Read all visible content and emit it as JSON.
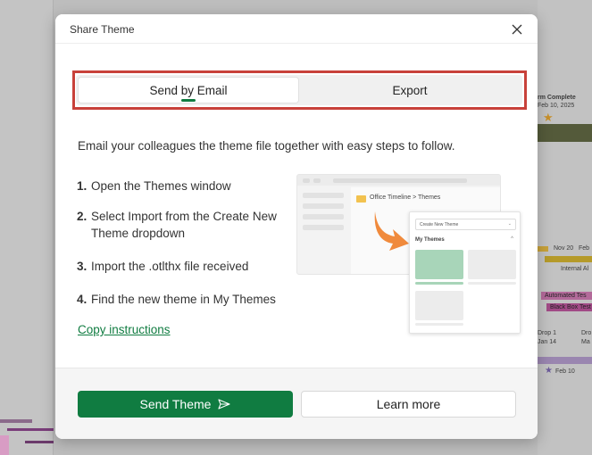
{
  "background": {
    "right_texts": [
      "rm Complete",
      "Feb 10, 2025",
      "Nov 20",
      "Feb",
      "Internal Al",
      "Automated Tes",
      "Black Box Test",
      "Drop 1",
      "Dro",
      "Jan 14",
      "Ma",
      "Feb 10"
    ]
  },
  "dialog": {
    "title": "Share Theme",
    "close_icon": "close-icon"
  },
  "tabs": [
    {
      "label": "Send by Email",
      "active": true
    },
    {
      "label": "Export",
      "active": false
    }
  ],
  "intro": "Email your colleagues the theme file together with easy steps to follow.",
  "steps": [
    {
      "num": "1.",
      "text": "Open the Themes window"
    },
    {
      "num": "2.",
      "text": "Select Import from the Create New Theme dropdown"
    },
    {
      "num": "3.",
      "text": "Import the .otlthx file received"
    },
    {
      "num": "4.",
      "text": "Find the new theme in My Themes"
    }
  ],
  "copy_link": "Copy instructions",
  "illustration": {
    "path": "Office Timeline > Themes",
    "dropdown": "Create New Theme",
    "section": "My Themes"
  },
  "footer": {
    "send_label": "Send Theme",
    "learn_label": "Learn more"
  },
  "colors": {
    "accent": "#107c41",
    "highlight": "#c8413a"
  }
}
